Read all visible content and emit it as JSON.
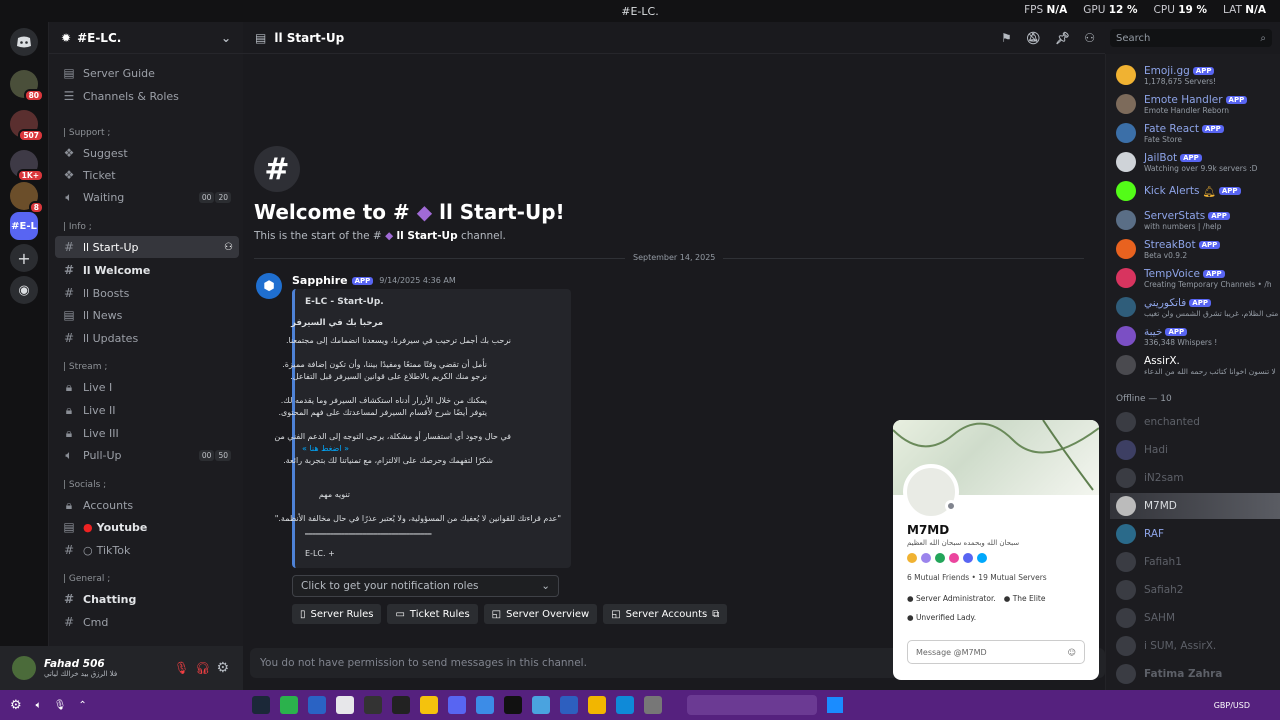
{
  "title": "#E-LC.",
  "stats": {
    "fps_label": "FPS",
    "fps": "N/A",
    "gpu_label": "GPU",
    "gpu": "12 %",
    "cpu_label": "CPU",
    "cpu": "19 %",
    "lat_label": "LAT",
    "lat": "N/A"
  },
  "rail": {
    "badges": [
      "80",
      "507",
      "1K+",
      "8"
    ],
    "current": "#E-L"
  },
  "sidebar": {
    "server_name": "#E-LC.",
    "guide": "Server Guide",
    "roles": "Channels & Roles",
    "categories": {
      "support": "| Support ;",
      "info": "| Info ;",
      "stream": "| Stream ;",
      "socials": "| Socials ;",
      "general": "| General ;"
    },
    "channels": {
      "suggest": "Suggest",
      "ticket": "Ticket",
      "waiting": "Waiting",
      "startup": "ll Start-Up",
      "welcome": "ll Welcome",
      "boosts": "ll Boosts",
      "news": "ll News",
      "updates": "ll Updates",
      "live1": "Live I",
      "live2": "Live II",
      "live3": "Live III",
      "pullup": "Pull-Up",
      "accounts": "Accounts",
      "youtube": "Youtube",
      "tiktok": "TikTok",
      "chatting": "Chatting",
      "cmd": "Cmd"
    },
    "waiting_counts": [
      "00",
      "20"
    ],
    "pullup_counts": [
      "00",
      "50"
    ]
  },
  "user": {
    "name": "Fahad 506",
    "status": "فلا الرزق بيد خرالك ليأتي"
  },
  "header": {
    "channel": "ll Start-Up"
  },
  "search": {
    "placeholder": "Search"
  },
  "welcome": {
    "title": "Welcome to #",
    "title_channel": "ll Start-Up!",
    "subtitle_pre": "This is the start of the #",
    "subtitle_channel": "ll Start-Up",
    "subtitle_post": "channel."
  },
  "divider_date": "September 14, 2025",
  "message": {
    "author": "Sapphire",
    "app_label": "APP",
    "timestamp": "9/14/2025 4:36 AM",
    "embed": {
      "title": "E-LC - Start-Up.",
      "line1": "مرحبا بك في السيرفر",
      "line2": "نرحب بك أجمل ترحيب في سيرفرنا، ويسعدنا انضمامك إلى مجتمعنا.",
      "line3": "نأمل أن تقضي وقتًا ممتعًا ومفيدًا بيننا، وأن تكون إضافة مميزة.",
      "line4": "نرجو منك الكريم بالاطلاع على قوانين السيرفر قبل التفاعل.",
      "line5": "يمكنك من خلال الأزرار أدناه استكشاف السيرفر وما يقدمه لك.",
      "line6": "يتوفر أيضًا شرح لأقسام السيرفر لمساعدتك على فهم المحتوى.",
      "line7": "في حال وجود أي استفسار أو مشكلة، يرجى التوجه إلى الدعم الفني من",
      "line8": "« اضغط هنا »",
      "line9": "شكرًا لتفهمك وحرصك على الالتزام، مع تمنياتنا لك بتجربة رائعة.",
      "line10": "تنويه مهم",
      "line11": "\"عدم قراءتك للقوانين لا يُعفيك من المسؤولية، ولا يُعتبر عذرًا في حال مخالفة الأنظمة.\"",
      "rule": "━━━━━━━━━━━━━━━━━━━━━━━━━━━━━━━━━━━",
      "footer": "E-LC. +"
    },
    "select_placeholder": "Click to get your notification roles",
    "buttons": [
      "Server Rules",
      "Ticket Rules",
      "Server Overview",
      "Server Accounts"
    ]
  },
  "composer": {
    "placeholder": "You do not have permission to send messages in this channel."
  },
  "members": {
    "online": [
      {
        "name": "Emoji.gg",
        "app": "APP",
        "sub": "1,178,675 Servers!"
      },
      {
        "name": "Emote Handler",
        "app": "APP",
        "sub": "Emote Handler Reborn"
      },
      {
        "name": "Fate React",
        "app": "APP",
        "sub": "Fate Store"
      },
      {
        "name": "JailBot",
        "app": "APP",
        "sub": "Watching over 9.9k servers :D"
      },
      {
        "name": "Kick Alerts",
        "app": "APP",
        "sub": ""
      },
      {
        "name": "ServerStats",
        "app": "APP",
        "sub": "with numbers | /help"
      },
      {
        "name": "StreakBot",
        "app": "APP",
        "sub": "Beta v0.9.2"
      },
      {
        "name": "TempVoice",
        "app": "APP",
        "sub": "Creating Temporary Channels • /h"
      },
      {
        "name": "فاتكوريني",
        "app": "APP",
        "sub": "إلى متى الظلام، غريبا تشرق الشمس ولن تغيب"
      },
      {
        "name": "خيبة",
        "app": "APP",
        "sub": "336,348 Whispers !"
      },
      {
        "name": "AssirX.",
        "app": "",
        "sub": "لا تنسون اخوانا كتائب رحمه الله من الدعاء"
      }
    ],
    "offline_header": "Offline — 10",
    "offline": [
      "enchanted",
      "Hadi",
      "iN2sam",
      "M7MD",
      "RAF",
      "Fafiah1",
      "Safiah2",
      "SAHM",
      "i SUM, AssirX.",
      "Fatima Zahra"
    ]
  },
  "popout": {
    "name": "M7MD",
    "bio": "سبحان الله وبحمده سبحان الله العظيم",
    "mutual": "6 Mutual Friends • 19 Mutual Servers",
    "roles": [
      "Server Administrator.",
      "The Elite",
      "Unverified Lady."
    ],
    "message_placeholder": "Message @M7MD"
  },
  "taskbar": {
    "time": "GBP/USD"
  },
  "colors": {
    "accent": "#5865f2",
    "taskbar": "#55217e",
    "embed_border": "#4e82d6"
  }
}
